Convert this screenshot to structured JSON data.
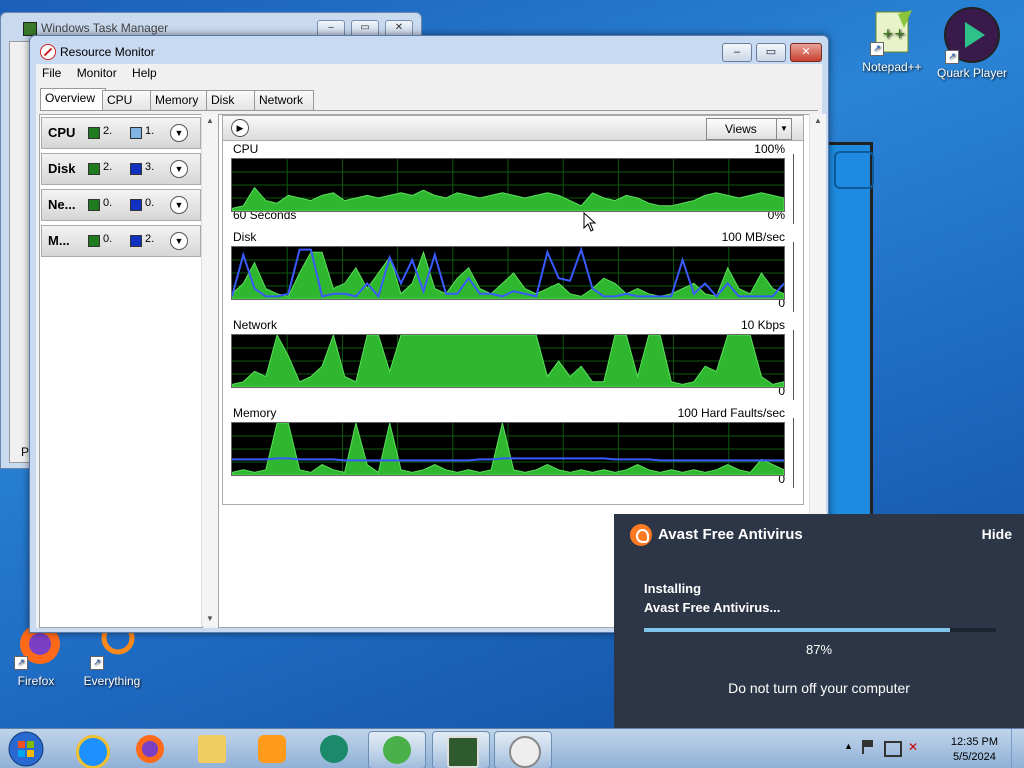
{
  "desktop": {
    "icons_right": [
      {
        "label": "Notepad++"
      },
      {
        "label": "Quark Player"
      }
    ],
    "icons_left": [
      {
        "label": "Firefox"
      },
      {
        "label": "Everything"
      }
    ]
  },
  "task_manager": {
    "title": "Windows Task Manager",
    "partial_text": "Pr"
  },
  "resource_monitor": {
    "title": "Resource Monitor",
    "window_buttons": {
      "minimize": "–",
      "maximize": "▭",
      "close": "✕"
    },
    "menu": [
      "File",
      "Monitor",
      "Help"
    ],
    "tabs": [
      "Overview",
      "CPU",
      "Memory",
      "Disk",
      "Network"
    ],
    "active_tab": "Overview",
    "sections": [
      {
        "name": "CPU",
        "v1": "2.",
        "v2": "1.",
        "c1": "#1e7b1e",
        "c2": "#7fb3e6"
      },
      {
        "name": "Disk",
        "v1": "2.",
        "v2": "3.",
        "c1": "#1e7b1e",
        "c2": "#1030c0"
      },
      {
        "name": "Ne...",
        "v1": "0.",
        "v2": "0.",
        "c1": "#1e7b1e",
        "c2": "#1030c0"
      },
      {
        "name": "M...",
        "v1": "0.",
        "v2": "2.",
        "c1": "#1e7b1e",
        "c2": "#1030c0"
      }
    ],
    "views_label": "Views",
    "graphs": [
      {
        "title": "CPU",
        "max": "100%",
        "left_bottom": "60 Seconds",
        "min": "0%",
        "green": [
          0.05,
          0.1,
          0.45,
          0.2,
          0.15,
          0.3,
          0.25,
          0.2,
          0.3,
          0.35,
          0.2,
          0.25,
          0.3,
          0.25,
          0.3,
          0.35,
          0.3,
          0.4,
          0.3,
          0.25,
          0.35,
          0.3,
          0.25,
          0.3,
          0.35,
          0.3,
          0.25,
          0.3,
          0.35,
          0.3,
          0.2,
          0.1,
          0.35,
          0.25,
          0.2,
          0.3,
          0.25,
          0.15,
          0.1,
          0.1,
          0.15,
          0.2,
          0.3,
          0.35,
          0.3,
          0.25,
          0.3,
          0.35,
          0.3,
          0.25
        ],
        "blue": []
      },
      {
        "title": "Disk",
        "max": "100 MB/sec",
        "left_bottom": "",
        "min": "0",
        "green": [
          0.1,
          0.3,
          0.7,
          0.2,
          0.1,
          0.05,
          0.5,
          0.9,
          0.9,
          0.2,
          0.3,
          0.6,
          0.2,
          0.5,
          0.8,
          0.1,
          0.3,
          0.9,
          0.2,
          0.1,
          0.4,
          0.6,
          0.2,
          0.1,
          0.3,
          0.5,
          0.2,
          0.1,
          0.2,
          0.3,
          0.1,
          0.05,
          0.2,
          0.4,
          0.3,
          0.1,
          0.2,
          0.1,
          0.05,
          0.1,
          0.2,
          0.3,
          0.1,
          0.05,
          0.6,
          0.2,
          0.1,
          0.5,
          0.2,
          0.1
        ],
        "blue": [
          0.05,
          0.85,
          0.2,
          0.05,
          0.05,
          0.1,
          0.95,
          0.95,
          0.05,
          0.1,
          0.1,
          0.05,
          0.3,
          0.05,
          0.8,
          0.3,
          0.75,
          0.15,
          0.85,
          0.1,
          0.1,
          0.4,
          0.1,
          0.1,
          0.05,
          0.15,
          0.1,
          0.05,
          0.9,
          0.4,
          0.35,
          0.95,
          0.2,
          0.05,
          0.05,
          0.1,
          0.05,
          0.05,
          0.05,
          0.05,
          0.75,
          0.1,
          0.3,
          0.05,
          0.3,
          0.05,
          0.05,
          0.05,
          0.05,
          0.3
        ]
      },
      {
        "title": "Network",
        "max": "10 Kbps",
        "left_bottom": "",
        "min": "0",
        "green": [
          0.05,
          0.1,
          0.3,
          0.2,
          1.0,
          0.6,
          0.1,
          0.2,
          0.4,
          1.0,
          0.2,
          0.1,
          1.0,
          1.0,
          0.3,
          1.0,
          1.0,
          1.0,
          1.0,
          1.0,
          1.0,
          1.0,
          1.0,
          1.0,
          1.0,
          1.0,
          1.0,
          1.0,
          0.2,
          0.5,
          0.2,
          0.4,
          0.1,
          0.1,
          1.0,
          1.0,
          0.2,
          1.0,
          1.0,
          0.1,
          0.05,
          0.1,
          0.4,
          0.3,
          1.0,
          1.0,
          1.0,
          0.2,
          0.05,
          0.1
        ],
        "blue": []
      },
      {
        "title": "Memory",
        "max": "100 Hard Faults/sec",
        "left_bottom": "",
        "min": "0",
        "green": [
          0.05,
          0.1,
          0.05,
          0.1,
          1.0,
          1.0,
          0.1,
          0.05,
          0.2,
          0.1,
          0.05,
          1.0,
          0.2,
          0.05,
          1.0,
          0.1,
          0.05,
          0.1,
          0.2,
          0.1,
          0.05,
          0.1,
          0.05,
          0.1,
          1.0,
          0.1,
          0.05,
          0.1,
          0.2,
          0.1,
          0.05,
          0.1,
          0.05,
          0.1,
          0.05,
          0.1,
          0.2,
          0.1,
          0.05,
          0.1,
          0.05,
          0.1,
          0.05,
          0.1,
          0.2,
          0.1,
          0.05,
          0.3,
          0.2,
          0.1
        ],
        "blue": [
          0.3,
          0.3,
          0.3,
          0.3,
          0.32,
          0.32,
          0.3,
          0.3,
          0.3,
          0.3,
          0.28,
          0.28,
          0.28,
          0.28,
          0.28,
          0.28,
          0.28,
          0.28,
          0.28,
          0.28,
          0.28,
          0.28,
          0.3,
          0.3,
          0.32,
          0.32,
          0.32,
          0.32,
          0.32,
          0.32,
          0.32,
          0.32,
          0.32,
          0.32,
          0.3,
          0.3,
          0.3,
          0.3,
          0.28,
          0.28,
          0.28,
          0.28,
          0.28,
          0.28,
          0.28,
          0.28,
          0.28,
          0.28,
          0.28,
          0.28
        ]
      }
    ]
  },
  "avast": {
    "title": "Avast Free Antivirus",
    "hide_label": "Hide",
    "line1": "Installing",
    "line2": "Avast Free Antivirus...",
    "progress_value": 0.87,
    "progress_label": "87%",
    "note": "Do not turn off your computer",
    "brand_color": "#ff7a22"
  },
  "taskbar": {
    "apps": [
      "start-orb",
      "internet-explorer",
      "firefox",
      "file-explorer",
      "media-player",
      "quark-player",
      "download-installer",
      "task-manager",
      "resource-monitor"
    ],
    "time": "12:35 PM",
    "date": "5/5/2024",
    "tray_chevron": "▲"
  }
}
